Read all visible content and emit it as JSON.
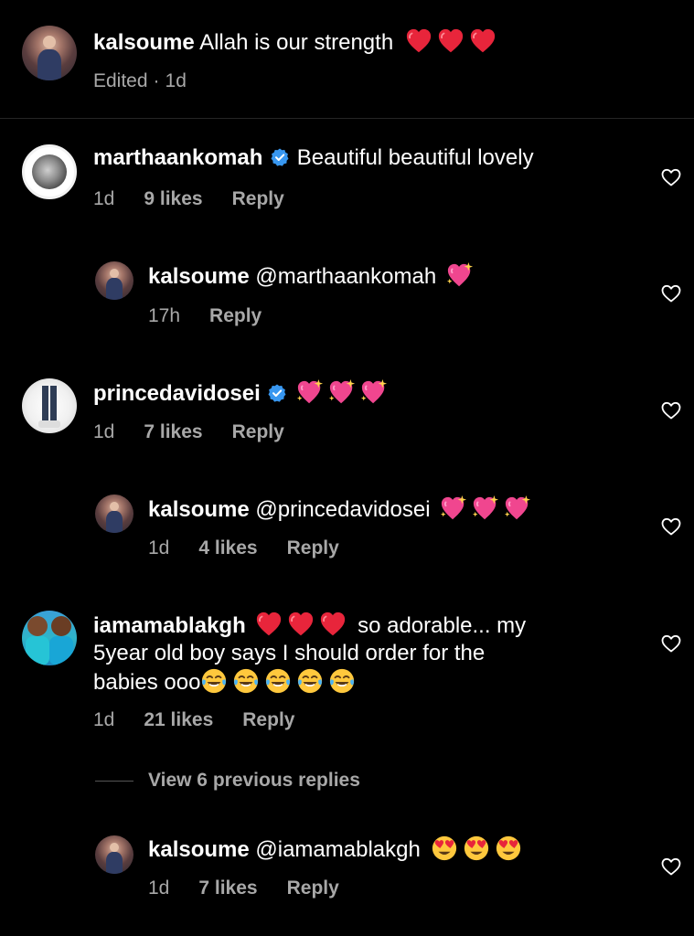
{
  "caption": {
    "username": "kalsoume",
    "text": "Allah is our strength",
    "emojis": [
      "red-heart",
      "red-heart",
      "red-heart"
    ],
    "edited_label": "Edited",
    "time": "1d"
  },
  "comments": [
    {
      "username": "marthaankomah",
      "verified": true,
      "text": "Beautiful beautiful lovely",
      "time": "1d",
      "likes": "9 likes",
      "reply_label": "Reply"
    },
    {
      "username": "kalsoume",
      "text": "@marthaankomah",
      "emojis": [
        "sparkling-heart"
      ],
      "time": "17h",
      "reply_label": "Reply"
    },
    {
      "username": "princedavidosei",
      "verified": true,
      "text": "",
      "emojis": [
        "sparkling-heart",
        "sparkling-heart",
        "sparkling-heart"
      ],
      "time": "1d",
      "likes": "7 likes",
      "reply_label": "Reply"
    },
    {
      "username": "kalsoume",
      "text": "@princedavidosei",
      "emojis": [
        "sparkling-heart",
        "sparkling-heart",
        "sparkling-heart"
      ],
      "time": "1d",
      "likes": "4 likes",
      "reply_label": "Reply"
    },
    {
      "username": "iamamablakgh",
      "text_part1": "so adorable... my",
      "text_line2": "5year old boy says I should order for the",
      "text_line3": "babies ooo",
      "emojis": [
        "red-heart",
        "red-heart",
        "red-heart"
      ],
      "trailing_emojis": [
        "tears-of-joy",
        "tears-of-joy",
        "tears-of-joy",
        "tears-of-joy",
        "tears-of-joy"
      ],
      "time": "1d",
      "likes": "21 likes",
      "reply_label": "Reply"
    },
    {
      "username": "kalsoume",
      "text": "@iamamablakgh",
      "emojis": [
        "heart-eyes",
        "heart-eyes",
        "heart-eyes"
      ],
      "time": "1d",
      "likes": "7 likes",
      "reply_label": "Reply"
    }
  ],
  "view_replies": "View 6 previous replies",
  "icons": {
    "like": "heart-outline-icon",
    "verified": "verified-badge-icon"
  },
  "colors": {
    "background": "#000000",
    "text": "#ffffff",
    "meta": "#a8a8a8",
    "verified": "#3897f0",
    "divider": "#262626"
  }
}
